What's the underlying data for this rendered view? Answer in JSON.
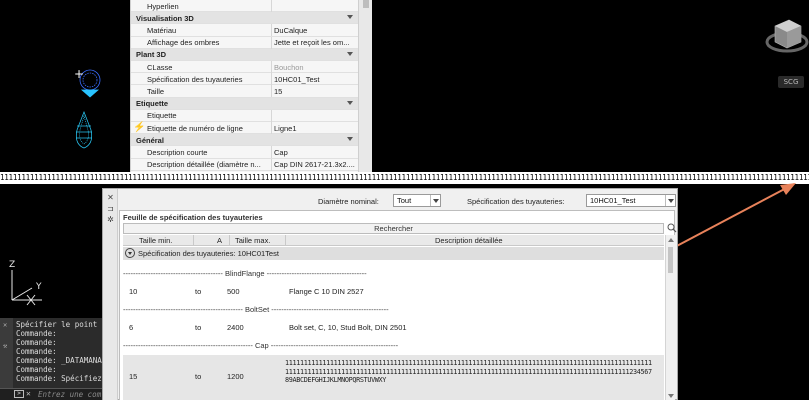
{
  "properties": {
    "rows": [
      {
        "type": "row",
        "key": "Hyperlien",
        "value": ""
      },
      {
        "type": "cat",
        "key": "Visualisation 3D"
      },
      {
        "type": "row",
        "key": "Matériau",
        "value": "DuCalque"
      },
      {
        "type": "row",
        "key": "Affichage des ombres",
        "value": "Jette et reçoit les om..."
      },
      {
        "type": "cat",
        "key": "Plant 3D"
      },
      {
        "type": "row",
        "key": "CLasse",
        "value": "Bouchon",
        "grey": true
      },
      {
        "type": "row",
        "key": "Spécification des tuyauteries",
        "value": "10HC01_Test"
      },
      {
        "type": "row",
        "key": "Taille",
        "value": "15"
      },
      {
        "type": "cat",
        "key": "Etiquette"
      },
      {
        "type": "row",
        "key": "Etiquette",
        "value": ""
      },
      {
        "type": "row",
        "key": "Etiquette de numéro de ligne",
        "value": "Ligne1",
        "bolt": true
      },
      {
        "type": "cat",
        "key": "Général"
      },
      {
        "type": "row",
        "key": "Description courte",
        "value": "Cap"
      },
      {
        "type": "row",
        "key": "Description détaillée (diamètre n...",
        "value": "Cap DIN 2617-21.3x2...."
      }
    ]
  },
  "ruler_text": "1111111111111111111111111111111111111111111111111111111111111111111111111111111111111111111111111111111111111111111111111111111111111111111111111111111111111111111111111111111111111111111111111111111111111111111111111111111111111111111111111111111111111111111111112345",
  "viewcube": {
    "badge": "SCG"
  },
  "dialog": {
    "diameter_label": "Diamètre nominal:",
    "diameter_value": "Tout",
    "spec_label": "Spécification des tuyauteries:",
    "spec_value": "10HC01_Test",
    "panel_title": "Feuille de spécification des tuyauteries",
    "search_label": "Rechercher",
    "columns": [
      "Taille min.",
      "A",
      "Taille max.",
      "Description détaillée"
    ],
    "spec_group": "Spécification des tuyauteries: 10HC01Test",
    "sections": [
      {
        "header": "---------------------------------------- BlindFlange ----------------------------------------",
        "min": "10",
        "to": "to",
        "max": "500",
        "desc": "Flange C 10 DIN 2527"
      },
      {
        "header": "------------------------------------------------ BoltSet -----------------------------------------------",
        "min": "6",
        "to": "to",
        "max": "2400",
        "desc": "Bolt set, C, 10, Stud Bolt, DIN 2501"
      },
      {
        "header": "---------------------------------------------------- Cap ---------------------------------------------------",
        "min": "15",
        "to": "to",
        "max": "1200",
        "desc": "111111111111111111111111111111111111111111111111111111111111111111111111111111111111111111111111111111111111111111111111111111111111111111111111111111111111111111111111111111111111111111111123456789ABCDEFGHIJKLMNOPQRSTUVWXY"
      }
    ]
  },
  "command": {
    "lines": [
      "Spécifier le point",
      "Commande:",
      "Commande:",
      "Commande:",
      "Commande: _DATAMANA",
      "Commande:",
      "Commande: Spécifiez"
    ],
    "placeholder": "Entrez une com"
  },
  "colors": {
    "arrow": "#e8825a",
    "ucs": "#ffffff"
  }
}
